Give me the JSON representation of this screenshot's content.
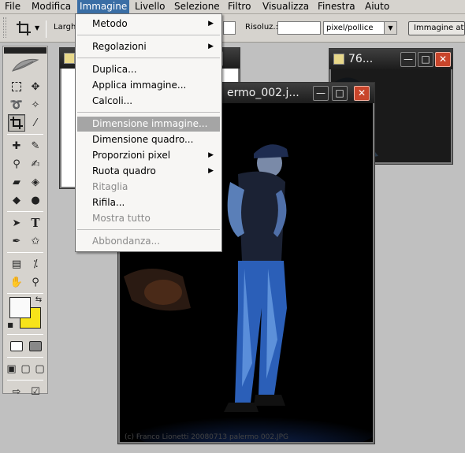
{
  "menubar": {
    "items": [
      "File",
      "Modifica",
      "Immagine",
      "Livello",
      "Selezione",
      "Filtro",
      "Visualizza",
      "Finestra",
      "Aiuto"
    ],
    "active": "Immagine"
  },
  "options_bar": {
    "width_label": "Larghe",
    "resolution_label": "Risoluz.:",
    "resolution_value": "",
    "unit_select": "pixel/pollice",
    "front_image_button": "Immagine attiva"
  },
  "menu": {
    "items": [
      {
        "label": "Metodo",
        "submenu": true,
        "enabled": true
      },
      {
        "label": "Regolazioni",
        "submenu": true,
        "enabled": true
      },
      {
        "label": "Duplica...",
        "submenu": false,
        "enabled": true
      },
      {
        "label": "Applica immagine...",
        "submenu": false,
        "enabled": true
      },
      {
        "label": "Calcoli...",
        "submenu": false,
        "enabled": true
      },
      {
        "label": "Dimensione immagine...",
        "submenu": false,
        "enabled": true,
        "highlighted": true
      },
      {
        "label": "Dimensione quadro...",
        "submenu": false,
        "enabled": true
      },
      {
        "label": "Proporzioni pixel",
        "submenu": true,
        "enabled": true
      },
      {
        "label": "Ruota quadro",
        "submenu": true,
        "enabled": true
      },
      {
        "label": "Ritaglia",
        "submenu": false,
        "enabled": false
      },
      {
        "label": "Rifila...",
        "submenu": false,
        "enabled": true
      },
      {
        "label": "Mostra tutto",
        "submenu": false,
        "enabled": false
      },
      {
        "label": "Abbondanza...",
        "submenu": false,
        "enabled": false
      }
    ]
  },
  "windows": {
    "back_left": {
      "title": ""
    },
    "right": {
      "title": "76..."
    },
    "main": {
      "title": "ermo_002.j...",
      "watermark": "(c) Franco Lionetti   20080713   palermo   002.JPG"
    }
  },
  "colors": {
    "foreground": "#fafafa",
    "background": "#f7e31a",
    "menu_highlight": "#a5a5a5",
    "active_menu": "#3a6ea5"
  },
  "icons": {
    "window_minimize": "minimize-icon",
    "window_maximize": "maximize-icon",
    "window_close": "close-icon"
  }
}
